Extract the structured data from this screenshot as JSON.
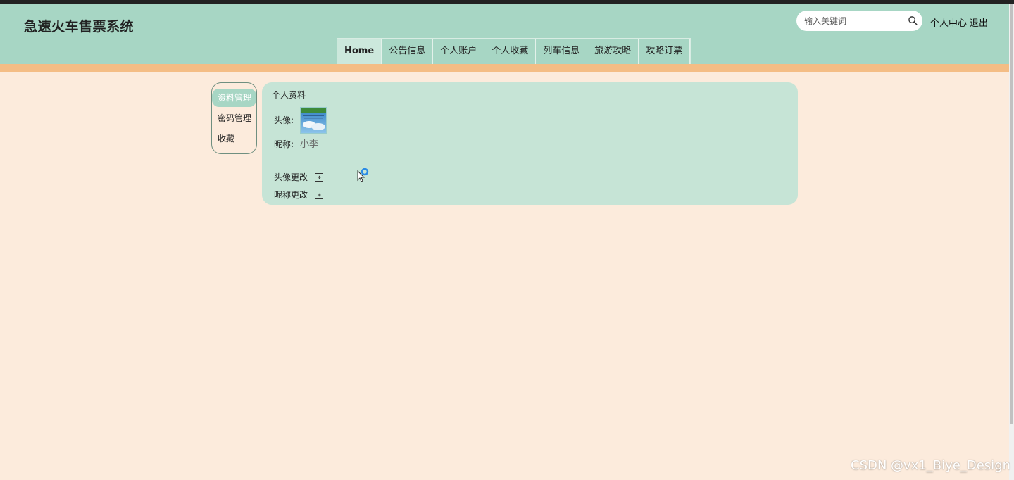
{
  "site": {
    "title": "急速火车售票系统"
  },
  "search": {
    "placeholder": "输入关键词"
  },
  "header_links": {
    "user_center": "个人中心",
    "logout": "退出"
  },
  "nav": {
    "items": [
      "Home",
      "公告信息",
      "个人账户",
      "个人收藏",
      "列车信息",
      "旅游攻略",
      "攻略订票"
    ],
    "active": "Home"
  },
  "sidemenu": {
    "items": [
      "资料管理",
      "密码管理",
      "收藏"
    ],
    "active": "资料管理"
  },
  "profile": {
    "title": "个人资料",
    "avatar_label": "头像:",
    "nickname_label": "昵称:",
    "nickname_value": "小李",
    "change_avatar": "头像更改",
    "change_nickname": "昵称更改"
  },
  "watermark": "CSDN @vx1_Biye_Design",
  "colors": {
    "header_bg": "#a7d6c4",
    "accent_bar": "#f4bd85",
    "page_bg": "#fcebdc",
    "panel_bg": "#c6e4d6"
  }
}
